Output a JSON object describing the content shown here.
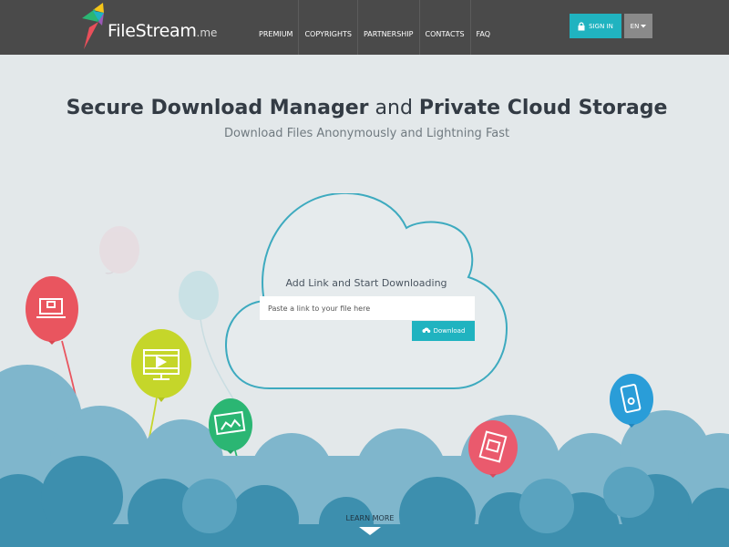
{
  "header": {
    "logo": {
      "name": "FileStream",
      "suffix": ".me"
    },
    "nav": [
      {
        "label": "PREMIUM"
      },
      {
        "label": "COPYRIGHTS"
      },
      {
        "label": "PARTNERSHIP"
      },
      {
        "label": "CONTACTS"
      },
      {
        "label": "FAQ"
      }
    ],
    "signin_label": "SIGN IN",
    "language": "EN"
  },
  "hero": {
    "title_part1": "Secure Download Manager",
    "title_joiner": "and",
    "title_part2": "Private Cloud Storage",
    "subtitle": "Download Files Anonymously and Lightning Fast"
  },
  "download_form": {
    "title": "Add Link and Start Downloading",
    "placeholder": "Paste a link to your file here",
    "button_label": "Download"
  },
  "learn_more": "LEARN MORE",
  "colors": {
    "header_bg": "#4a4a4a",
    "accent": "#20b3c0",
    "background": "#e3e8ea",
    "cloud_dark": "#3d8fae",
    "cloud_light": "#7fb6cc"
  },
  "icons": [
    "parrot-logo-icon",
    "lock-icon",
    "caret-down-icon",
    "cloud-download-icon",
    "chevron-down-icon",
    "folder-icon",
    "video-icon",
    "image-icon",
    "phone-music-icon",
    "tablet-video-icon"
  ]
}
